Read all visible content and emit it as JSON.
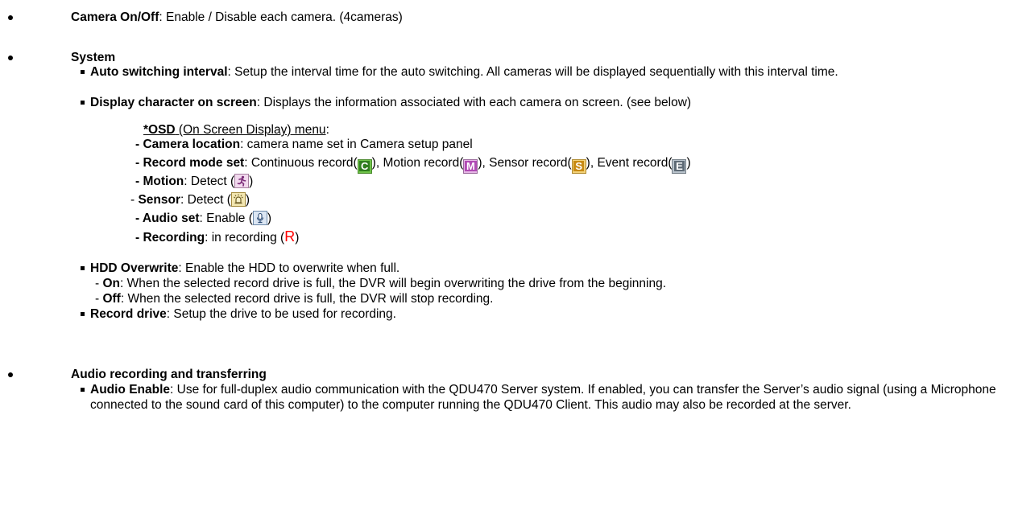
{
  "camera_onoff": {
    "label": "Camera On/Off",
    "text": ": Enable / Disable each camera. (4cameras)"
  },
  "system": {
    "heading": "System",
    "auto_switching": {
      "label": "Auto switching interval",
      "text": ": Setup the interval time for the auto switching. All cameras will be displayed sequentially with this interval time."
    },
    "display_character": {
      "label": "Display character on screen",
      "text": ": Displays the information associated with each camera on screen. (see below)"
    },
    "osd": {
      "heading_bold": "*OSD",
      "heading_rest": " (On Screen Display) menu",
      "heading_colon": ":",
      "camera_location_label": "- Camera location",
      "camera_location_text": ": camera name set in Camera setup panel",
      "record_mode_label": "- Record mode set",
      "record_mode_continuous": ": Continuous record(",
      "record_mode_motion": "), Motion record(",
      "record_mode_sensor": "), Sensor record(",
      "record_mode_event": "), Event record(",
      "close_paren": ")",
      "icon_c": "C",
      "icon_m": "M",
      "icon_s": "S",
      "icon_e": "E",
      "motion_label": "- Motion",
      "motion_text": ": Detect (",
      "sensor_prefix": "- ",
      "sensor_label": "Sensor",
      "sensor_text": ": Detect (",
      "audio_label": "- Audio set",
      "audio_text": ": Enable (",
      "recording_label": "- Recording",
      "recording_text": ": in recording (",
      "recording_icon": "R"
    },
    "hdd_overwrite": {
      "label": "HDD Overwrite",
      "text": ": Enable the HDD to overwrite when full.",
      "on_label": "On",
      "on_text": ": When the selected record drive is full, the DVR will begin overwriting the drive from the beginning.",
      "off_label": "Off",
      "off_text": ": When the selected record drive is full, the DVR will stop recording.",
      "dash": "- "
    },
    "record_drive": {
      "label": "Record drive",
      "text": ": Setup the drive to be used for recording."
    }
  },
  "audio": {
    "heading": "Audio recording and transferring",
    "enable": {
      "label": "Audio Enable",
      "text": ": Use for full-duplex audio communication with the QDU470 Server system. If enabled, you can transfer the Server’s audio signal (using a Microphone connected to the sound card of this computer) to the computer running the QDU470 Client. This audio may also be recorded at the server."
    }
  }
}
